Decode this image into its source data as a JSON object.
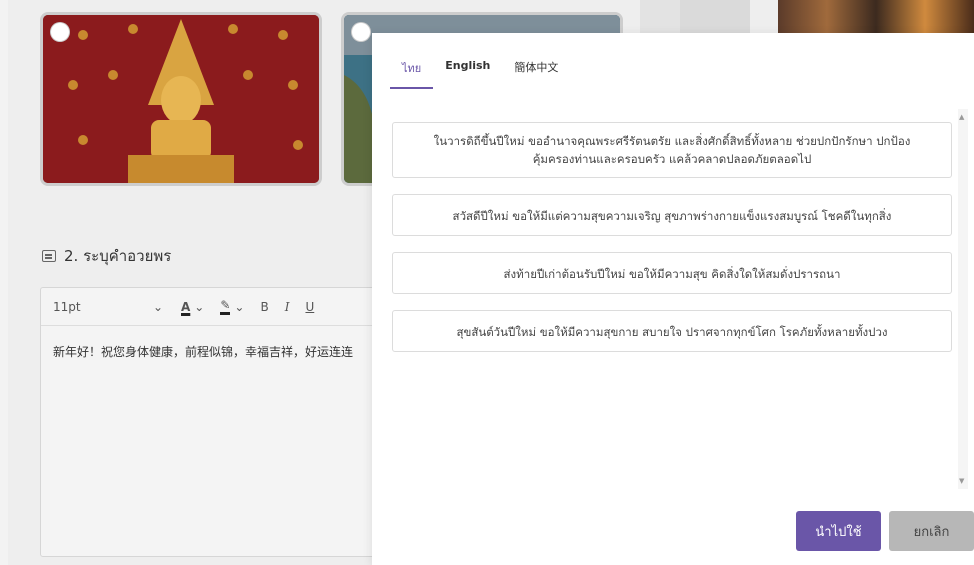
{
  "background": {
    "section_title": "2. ระบุคำอวยพร",
    "toolbar": {
      "font_size": "11pt",
      "font_color": "A",
      "bold": "B",
      "italic": "I",
      "underline": "U"
    },
    "editor_text": "新年好！祝您身体健康，前程似锦，幸福吉祥，好运连连"
  },
  "modal": {
    "tabs": [
      {
        "label": "ไทย",
        "active": true
      },
      {
        "label": "English",
        "active": false
      },
      {
        "label": "簡体中文",
        "active": false
      }
    ],
    "wishes": [
      {
        "line1": "ในวารดิถีขึ้นปีใหม่ ขออำนาจคุณพระศรีรัตนตรัย และสิ่งศักดิ์สิทธิ์ทั้งหลาย ช่วยปกปักรักษา ปกป้อง",
        "line2": "คุ้มครองท่านและครอบครัว แคล้วคลาดปลอดภัยตลอดไป"
      },
      {
        "line1": "สวัสดีปีใหม่ ขอให้มีแต่ความสุขความเจริญ สุขภาพร่างกายแข็งแรงสมบูรณ์ โชคดีในทุกสิ่ง"
      },
      {
        "line1": "ส่งท้ายปีเก่าต้อนรับปีใหม่ ขอให้มีความสุข คิดสิ่งใดให้สมดั่งปรารถนา"
      },
      {
        "line1": "สุขสันต์วันปีใหม่ ขอให้มีความสุขกาย สบายใจ ปราศจากทุกข์โศก โรคภัยทั้งหลายทั้งปวง"
      }
    ],
    "apply_label": "นำไปใช้",
    "cancel_label": "ยกเลิก"
  },
  "colors": {
    "accent": "#6a56a8",
    "cancel": "#b7b7b7"
  }
}
